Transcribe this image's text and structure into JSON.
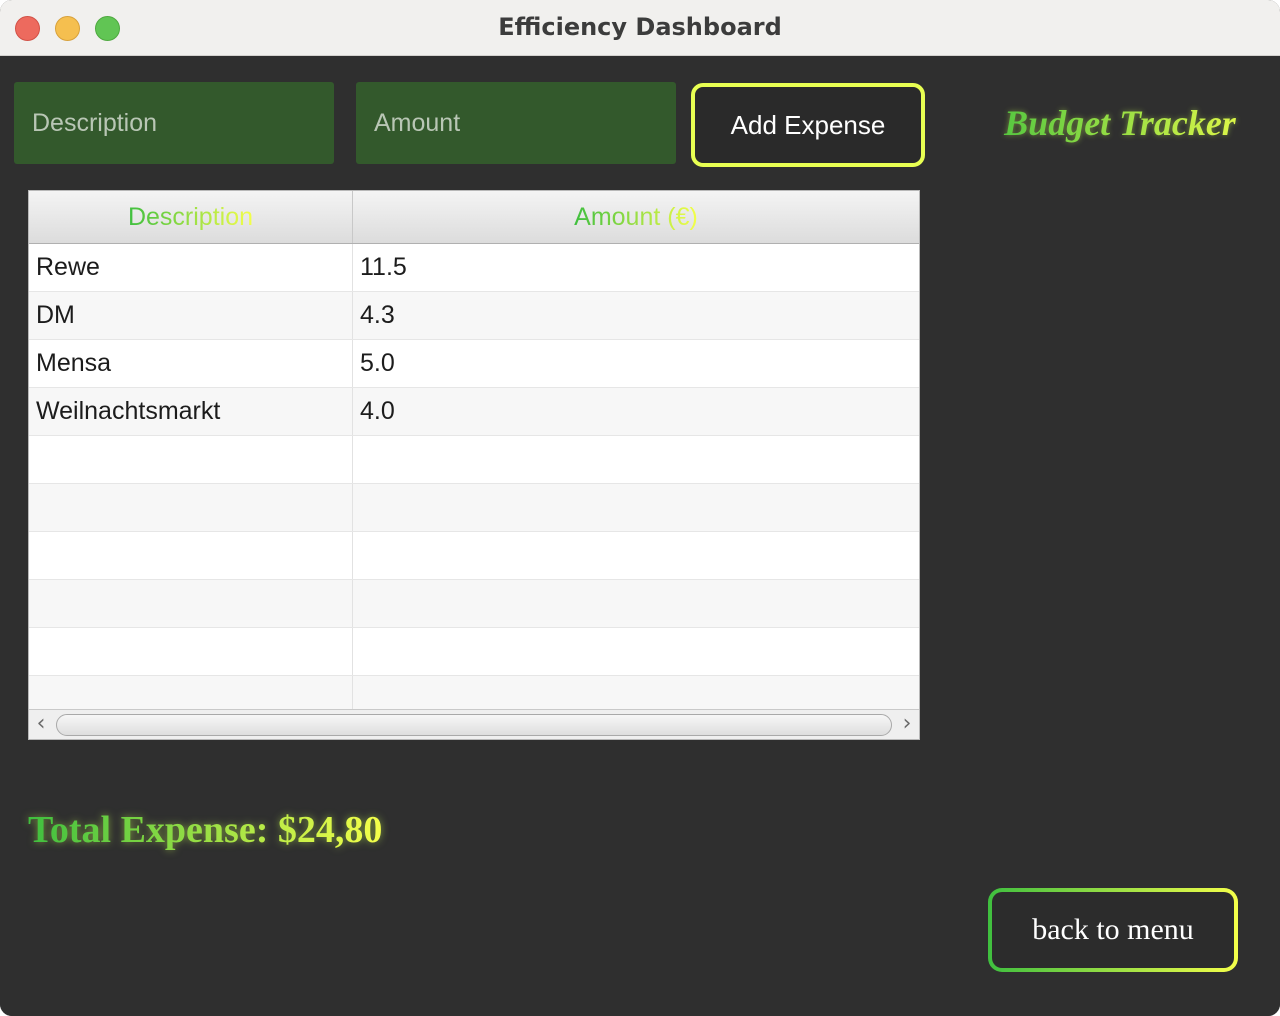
{
  "window": {
    "title": "Efficiency Dashboard"
  },
  "form": {
    "description_placeholder": "Description",
    "description_value": "",
    "amount_placeholder": "Amount",
    "amount_value": "",
    "add_label": "Add Expense"
  },
  "brand": {
    "title": "Budget Tracker"
  },
  "table": {
    "columns": [
      "Description",
      "Amount (€)"
    ],
    "rows": [
      [
        "Rewe",
        "11.5"
      ],
      [
        "DM",
        "4.3"
      ],
      [
        "Mensa",
        "5.0"
      ],
      [
        "Weilnachtsmarkt",
        "4.0"
      ],
      [
        "",
        ""
      ],
      [
        "",
        ""
      ],
      [
        "",
        ""
      ],
      [
        "",
        ""
      ],
      [
        "",
        ""
      ],
      [
        "",
        ""
      ]
    ]
  },
  "summary": {
    "total_label": "Total Expense: $24,80"
  },
  "nav": {
    "back_label": "back to menu"
  },
  "colors": {
    "accent_green": "#3fbf3f",
    "accent_yellow": "#f4ff4a",
    "field_bg": "#33592c",
    "background": "#2f2f2f"
  }
}
